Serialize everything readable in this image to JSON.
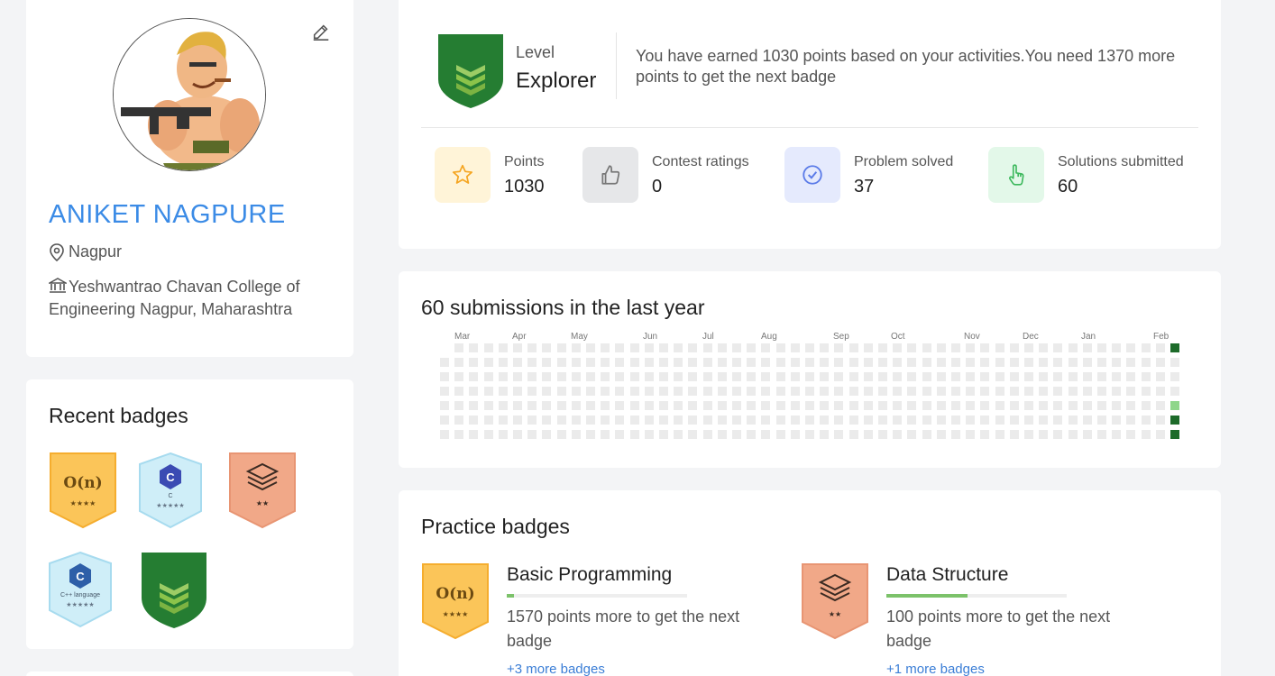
{
  "profile": {
    "name": "ANIKET NAGPURE",
    "location": "Nagpur",
    "college": "Yeshwantrao Chavan College of Engineering Nagpur, Maharashtra"
  },
  "recent_badges": {
    "title": "Recent badges",
    "items": [
      {
        "name": "complexity-badge",
        "symbol": "O(n)",
        "stars": "★★★★",
        "color": "#fbc559"
      },
      {
        "name": "c-badge",
        "symbol": "C",
        "caption": "C",
        "stars": "★★★★★",
        "color": "#cfeef8"
      },
      {
        "name": "data-structure-badge",
        "stars": "★★",
        "color": "#f1a888"
      },
      {
        "name": "cpp-badge",
        "symbol": "C",
        "caption": "C++ language",
        "stars": "★★★★★",
        "color": "#cfeef8"
      },
      {
        "name": "explorer-badge",
        "color": "#257d32"
      }
    ]
  },
  "level": {
    "label": "Level",
    "name": "Explorer",
    "message": "You have earned 1030 points based on your activities.You need 1370 more points to get the next badge"
  },
  "stats": [
    {
      "label": "Points",
      "value": "1030",
      "icon": "star-icon",
      "bg": "#fff4d8"
    },
    {
      "label": "Contest ratings",
      "value": "0",
      "icon": "thumbs-up-icon",
      "bg": "#e6e7e9"
    },
    {
      "label": "Problem solved",
      "value": "37",
      "icon": "check-circle-icon",
      "bg": "#e5eafd"
    },
    {
      "label": "Solutions submitted",
      "value": "60",
      "icon": "pointer-hand-icon",
      "bg": "#e3f8e9"
    }
  ],
  "submissions": {
    "title": "60 submissions in the last year",
    "months": [
      "Mar",
      "Apr",
      "May",
      "Jun",
      "Jul",
      "Aug",
      "Sep",
      "Oct",
      "Nov",
      "Dec",
      "Jan",
      "Feb"
    ]
  },
  "practice": {
    "title": "Practice badges",
    "items": [
      {
        "name": "Basic Programming",
        "progress": 0.04,
        "message": "1570 points more to get the next badge",
        "more": "+3 more badges",
        "symbol": "O(n)",
        "stars": "★★★★"
      },
      {
        "name": "Data Structure",
        "progress": 0.45,
        "message": "100 points more to get the next badge",
        "more": "+1 more badges",
        "stars": "★★"
      }
    ]
  },
  "colors": {
    "accent": "#3b8be6",
    "level_green": "#257d32",
    "chevron_green": "#8bc34a"
  }
}
